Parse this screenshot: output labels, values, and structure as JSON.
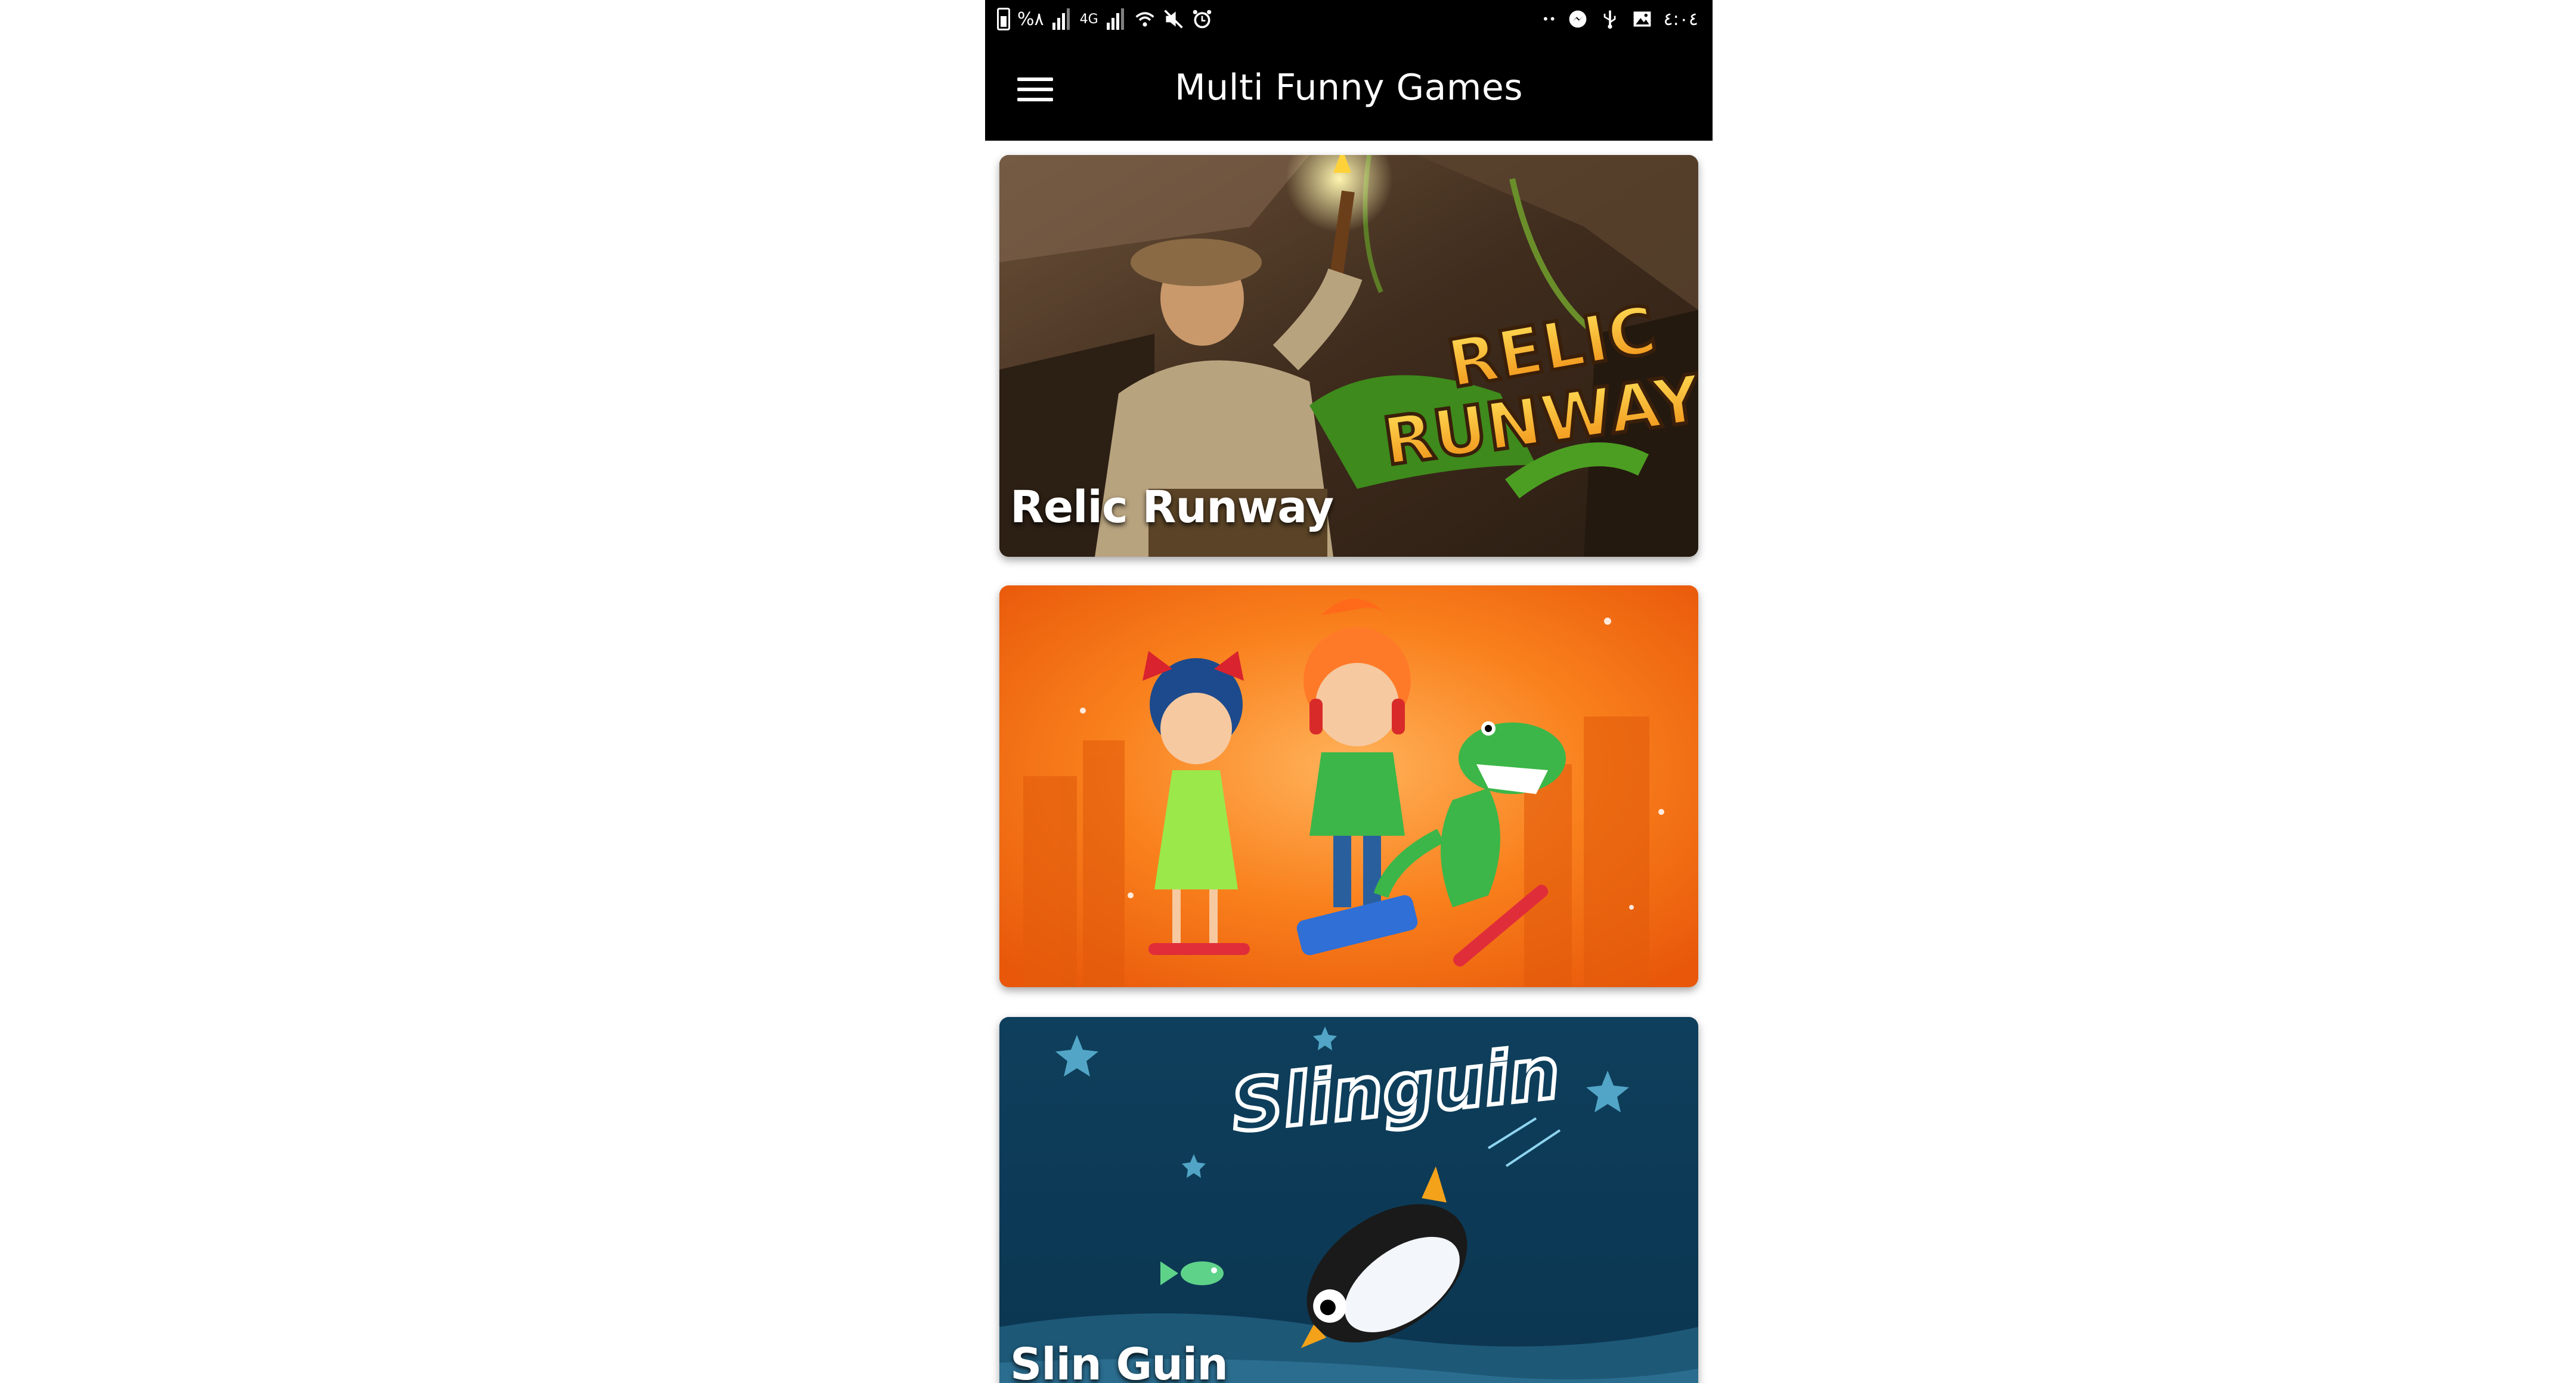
{
  "status_bar": {
    "left_text": "%٨",
    "network": "4G",
    "clock": "٤:٠٤",
    "left_dots": "••"
  },
  "app_bar": {
    "title": "Multi Funny Games",
    "menu_icon": "hamburger-menu-icon"
  },
  "games": [
    {
      "title": "Relic Runway",
      "art_logo_text": "RELIC RUNWAY",
      "theme": "jungle-temple"
    },
    {
      "title": "",
      "theme": "orange-skateboard-kids"
    },
    {
      "title": "Slin Guin",
      "art_logo_text": "Slinguin",
      "theme": "night-penguin"
    }
  ],
  "colors": {
    "app_bar_bg": "#000000",
    "page_bg": "#ffffff",
    "card1_bg": "#4a3624",
    "card2_bg": "#f26a12",
    "card3_bg": "#10425e"
  }
}
